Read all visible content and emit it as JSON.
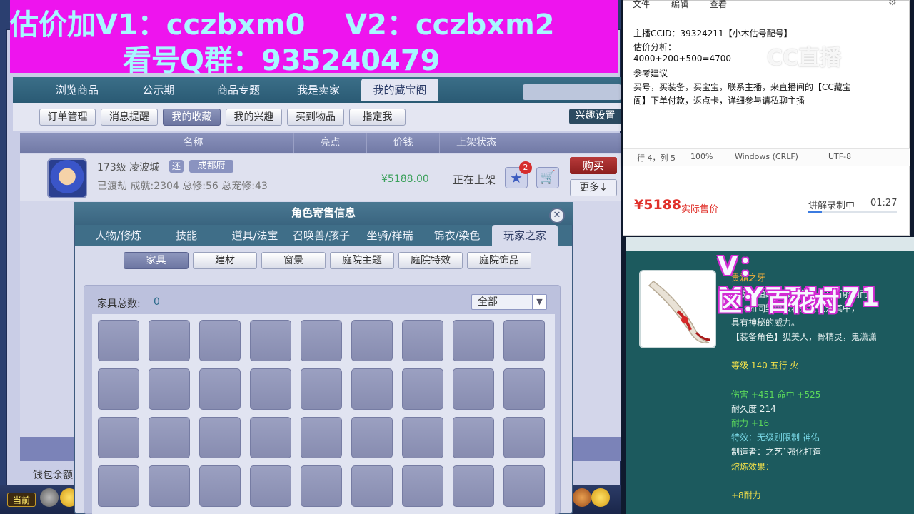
{
  "banner": {
    "line1": "估价加V1：cczbxm0    V2：cczbxm2",
    "line2": "看号Q群：935240479"
  },
  "nav": {
    "tabs": [
      "浏览商品",
      "公示期",
      "商品专题",
      "我是卖家",
      "我的藏宝阁"
    ],
    "active_index": 4
  },
  "subnav": {
    "buttons": [
      "订单管理",
      "消息提醒",
      "我的收藏",
      "我的兴趣",
      "买到物品",
      "指定我"
    ],
    "active_index": 2,
    "interest_settings": "兴趣设置"
  },
  "list": {
    "columns": [
      "名称",
      "亮点",
      "价钱",
      "上架状态"
    ],
    "row": {
      "level_server": "173级 凌波城",
      "tag_return": "还",
      "tag_sect": "成都府",
      "stats": "已渡劫 成就:2304 总修:56 总宠修:43",
      "price": "¥5188.00",
      "status": "正在上架",
      "favorite_count": "2",
      "buy_label": "购买",
      "more_label": "更多↓"
    },
    "wallet_label": "钱包余额"
  },
  "bottom": {
    "now_label": "当前"
  },
  "dialog": {
    "title": "角色寄售信息",
    "tabs": [
      "人物/修炼",
      "技能",
      "道具/法宝",
      "召唤兽/孩子",
      "坐骑/祥瑞",
      "锦衣/染色",
      "玩家之家"
    ],
    "active_tab": 6,
    "categories": [
      "家具",
      "建材",
      "窗景",
      "庭院主题",
      "庭院特效",
      "庭院饰品"
    ],
    "active_category": 0,
    "furniture_count_label": "家具总数:",
    "furniture_count": "0",
    "filter_value": "全部"
  },
  "notepad": {
    "menu": [
      "文件",
      "编辑",
      "查看"
    ],
    "lines": [
      "主播CCID：39324211【小木估号配号】",
      "估价分析：",
      "4000+200+500=4700",
      "参考建议",
      "买号，买装备，买宝宝，联系主播，来直播间的【CC藏宝",
      "阁】下单付款，返点卡，详细参与请私聊主播"
    ],
    "status": {
      "position": "行 4，列 5",
      "zoom": "100%",
      "line_ending": "Windows (CRLF)",
      "encoding": "UTF-8"
    },
    "watermark": "CC直播"
  },
  "stream": {
    "price": "¥5188",
    "price_label": "实际售价",
    "status": "讲解录制中",
    "time": "01:27",
    "progress": 0.15
  },
  "item": {
    "name": "贵霜之牙",
    "desc_lines": [
      "传说是由绝世锻造师以兽牙所雕刻而",
      "成，如同野兽般将杀意贯注其中，",
      "具有神秘的威力。"
    ],
    "role": "【装备角色】狐美人，骨精灵，鬼潇潇",
    "level": "等级 140 五行 火",
    "damage": "伤害 +451 命中 +525",
    "durability": "耐久度 214",
    "endurance": "耐力 +16",
    "special": "特效：无级别限制 神佑",
    "maker": "制造者：之艺ˇ强化打造",
    "forge": "熔炼效果：",
    "forge_bonus": "+8耐力"
  },
  "overlay": {
    "wechat": "V：MY771771",
    "region": "区：百花村"
  }
}
